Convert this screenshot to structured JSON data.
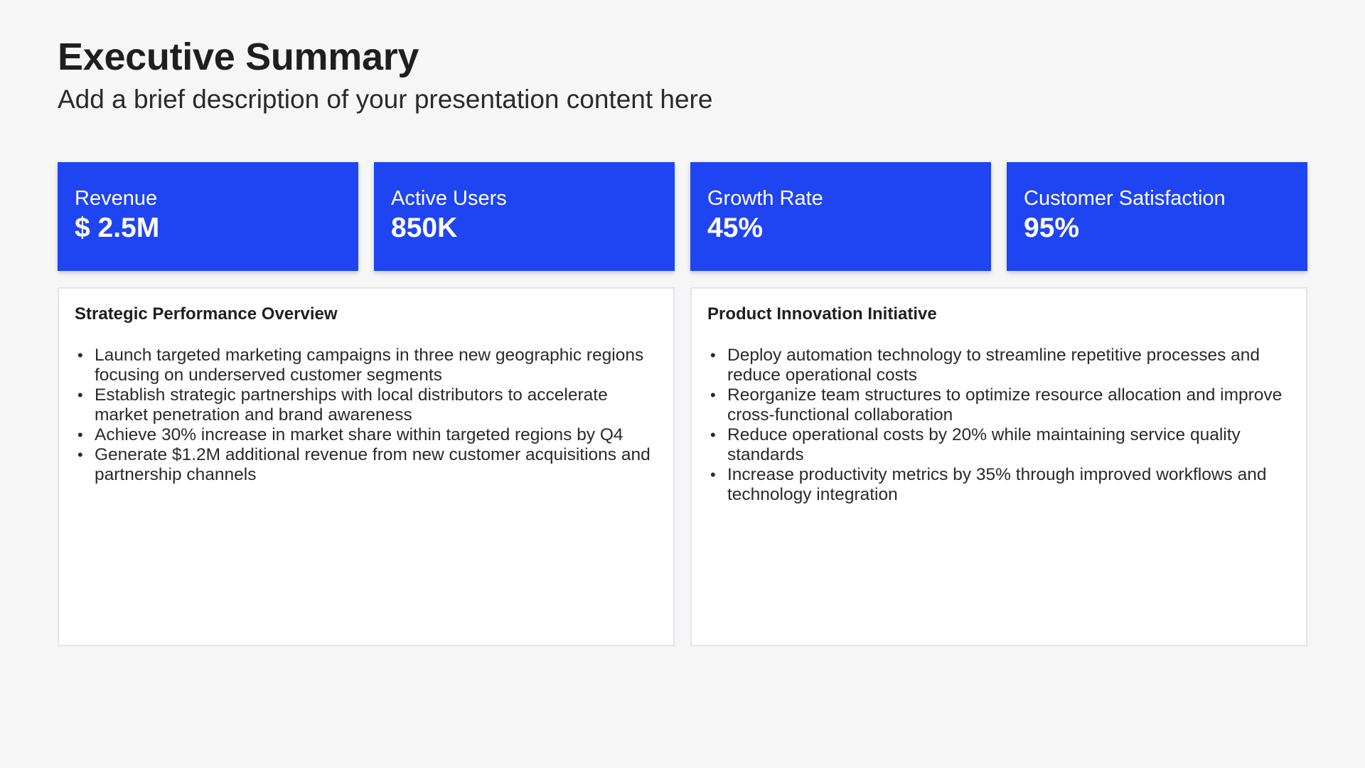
{
  "header": {
    "title": "Executive Summary",
    "subtitle": "Add a brief description of your presentation content here"
  },
  "kpis": [
    {
      "label": "Revenue",
      "value": "$ 2.5M"
    },
    {
      "label": "Active Users",
      "value": "850K"
    },
    {
      "label": "Growth Rate",
      "value": "45%"
    },
    {
      "label": "Customer Satisfaction",
      "value": "95%"
    }
  ],
  "panels": [
    {
      "title": "Strategic Performance Overview",
      "items": [
        "Launch targeted marketing campaigns in three new geographic regions focusing on underserved customer segments",
        "Establish strategic partnerships with local distributors to accelerate market penetration and brand awareness",
        "Achieve 30% increase in market share within targeted regions by Q4",
        "Generate $1.2M additional revenue from new customer acquisitions and partnership channels"
      ]
    },
    {
      "title": "Product Innovation Initiative",
      "items": [
        "Deploy automation technology to streamline repetitive processes and reduce operational costs",
        "Reorganize team structures to optimize resource allocation and improve cross-functional collaboration",
        "Reduce operational costs by 20% while maintaining service quality standards",
        "Increase productivity metrics by 35% through improved workflows and technology integration"
      ]
    }
  ],
  "colors": {
    "accent": "#1f44f2",
    "background": "#f6f6f6",
    "panel_border": "#e3e5ee"
  }
}
